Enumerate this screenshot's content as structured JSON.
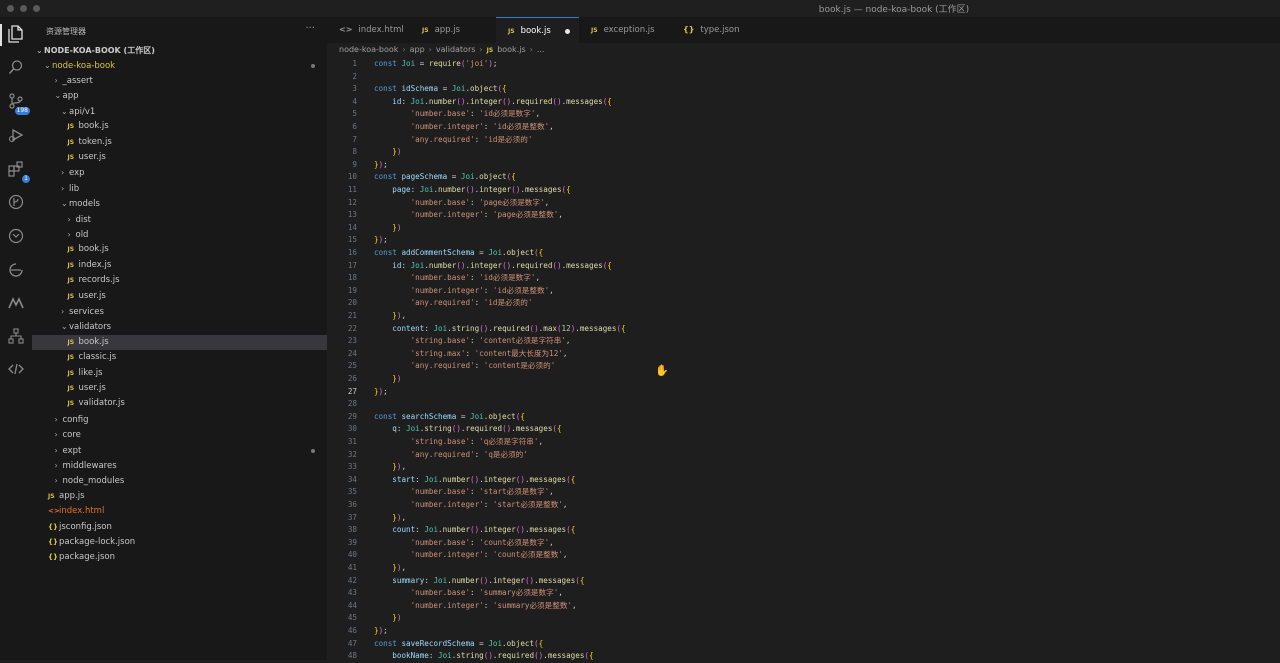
{
  "window": {
    "title": "book.js — node-koa-book (工作区)"
  },
  "activity_bar": {
    "badges": {
      "scm": "198",
      "extensions": "1"
    }
  },
  "sidebar": {
    "header": "资源管理器",
    "more": "···",
    "root": "NODE-KOA-BOOK (工作区)",
    "rows": [
      {
        "label": "_assert",
        "type": "folder",
        "expanded": false
      },
      {
        "label": "app",
        "type": "folder",
        "expanded": true
      },
      {
        "label": "api/v1",
        "type": "folder",
        "expanded": true
      },
      {
        "label": "book.js",
        "type": "js"
      },
      {
        "label": "token.js",
        "type": "js"
      },
      {
        "label": "user.js",
        "type": "js"
      },
      {
        "label": "exp",
        "type": "folder",
        "expanded": false
      },
      {
        "label": "lib",
        "type": "folder",
        "expanded": false
      },
      {
        "label": "models",
        "type": "folder",
        "expanded": true
      },
      {
        "label": "dist",
        "type": "folder",
        "expanded": false
      },
      {
        "label": "old",
        "type": "folder",
        "expanded": false
      },
      {
        "label": "book.js",
        "type": "js"
      },
      {
        "label": "index.js",
        "type": "js"
      },
      {
        "label": "records.js",
        "type": "js"
      },
      {
        "label": "user.js",
        "type": "js"
      },
      {
        "label": "services",
        "type": "folder",
        "expanded": false
      },
      {
        "label": "validators",
        "type": "folder",
        "expanded": true
      },
      {
        "label": "book.js",
        "type": "js",
        "selected": true
      },
      {
        "label": "classic.js",
        "type": "js"
      },
      {
        "label": "like.js",
        "type": "js"
      },
      {
        "label": "user.js",
        "type": "js"
      },
      {
        "label": "validator.js",
        "type": "js"
      },
      {
        "label": "config",
        "type": "folder",
        "expanded": false
      },
      {
        "label": "core",
        "type": "folder",
        "expanded": false
      },
      {
        "label": "expt",
        "type": "folder",
        "expanded": false
      },
      {
        "label": "middlewares",
        "type": "folder",
        "expanded": false
      },
      {
        "label": "node_modules",
        "type": "folder",
        "expanded": false
      },
      {
        "label": "app.js",
        "type": "js"
      },
      {
        "label": "index.html",
        "type": "html"
      },
      {
        "label": "jsconfig.json",
        "type": "json"
      },
      {
        "label": "package-lock.json",
        "type": "json"
      },
      {
        "label": "package.json",
        "type": "json"
      }
    ]
  },
  "tabs": [
    {
      "label": "index.html",
      "icon": "html"
    },
    {
      "label": "app.js",
      "icon": "js"
    },
    {
      "label": "book.js",
      "icon": "js",
      "active": true,
      "modified": true
    },
    {
      "label": "exception.js",
      "icon": "js"
    },
    {
      "label": "type.json",
      "icon": "json"
    }
  ],
  "breadcrumb": [
    "node-koa-book",
    "app",
    "validators",
    "book.js",
    "..."
  ],
  "editor": {
    "current_line": 27,
    "lines": [
      "const Joi = require('joi');",
      "",
      "const idSchema = Joi.object({",
      "    id: Joi.number().integer().required().messages({",
      "        'number.base': 'id必须是数字',",
      "        'number.integer': 'id必须是整数',",
      "        'any.required': 'id是必须的'",
      "    })",
      "});",
      "const pageSchema = Joi.object({",
      "    page: Joi.number().integer().messages({",
      "        'number.base': 'page必须是数字',",
      "        'number.integer': 'page必须是整数',",
      "    })",
      "});",
      "const addCommentSchema = Joi.object({",
      "    id: Joi.number().integer().required().messages({",
      "        'number.base': 'id必须是数字',",
      "        'number.integer': 'id必须是整数',",
      "        'any.required': 'id是必须的'",
      "    }),",
      "    content: Joi.string().required().max(12).messages({",
      "        'string.base': 'content必须是字符串',",
      "        'string.max': 'content最大长度为12',",
      "        'any.required': 'content是必须的'",
      "    })",
      "});",
      "",
      "const searchSchema = Joi.object({",
      "    q: Joi.string().required().messages({",
      "        'string.base': 'q必须是字符串',",
      "        'any.required': 'q是必须的'",
      "    }),",
      "    start: Joi.number().integer().messages({",
      "        'number.base': 'start必须是数字',",
      "        'number.integer': 'start必须是整数',",
      "    }),",
      "    count: Joi.number().integer().messages({",
      "        'number.base': 'count必须是数字',",
      "        'number.integer': 'count必须是整数',",
      "    }),",
      "    summary: Joi.number().integer().messages({",
      "        'number.base': 'summary必须是数字',",
      "        'number.integer': 'summary必须是整数',",
      "    })",
      "});",
      "const saveRecordSchema = Joi.object({",
      "    bookName: Joi.string().required().messages({"
    ]
  }
}
